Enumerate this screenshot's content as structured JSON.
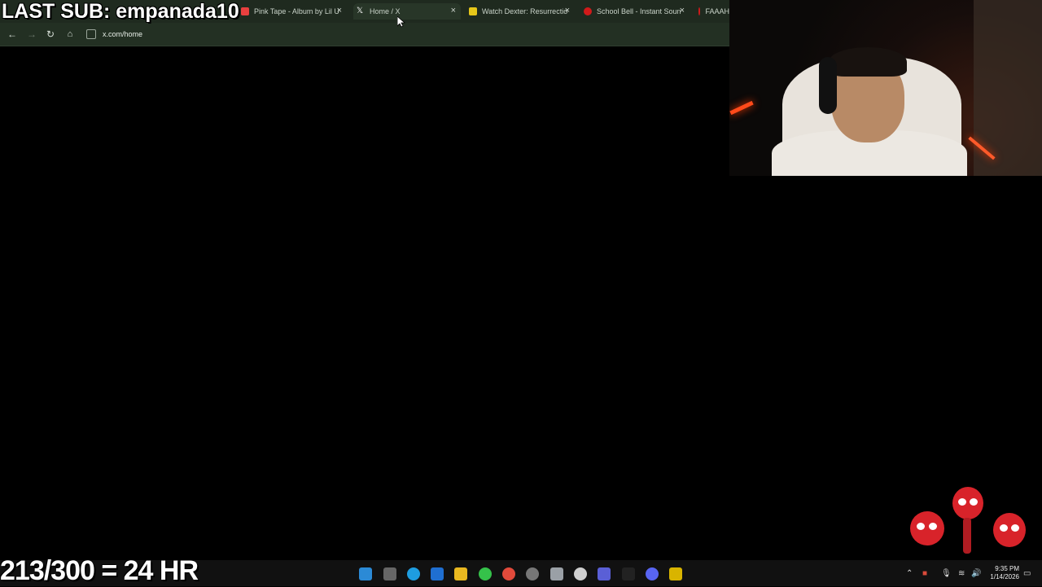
{
  "overlay": {
    "last_sub": "LAST SUB: empanada10",
    "sub_count": "213/300 = 24 HR"
  },
  "browser": {
    "tabs": [
      {
        "label": "Pink Tape - Album by Lil U",
        "icon": "music-icon",
        "color": "#e8403f"
      },
      {
        "label": "Home / X",
        "icon": "x-logo-icon",
        "color": "#ffffff"
      },
      {
        "label": "Watch Dexter: Resurrectio",
        "icon": "tv-icon",
        "color": "#e6c619"
      },
      {
        "label": "School Bell - Instant Soun",
        "icon": "sound-icon",
        "color": "#d11a1a"
      },
      {
        "label": "FAAAH",
        "icon": "sound-icon",
        "color": "#d11a1a"
      }
    ],
    "close_glyph": "×",
    "url": "x.com/home"
  },
  "taskbar": {
    "clock_time": "9:35 PM",
    "clock_date": "1/14/2026"
  }
}
